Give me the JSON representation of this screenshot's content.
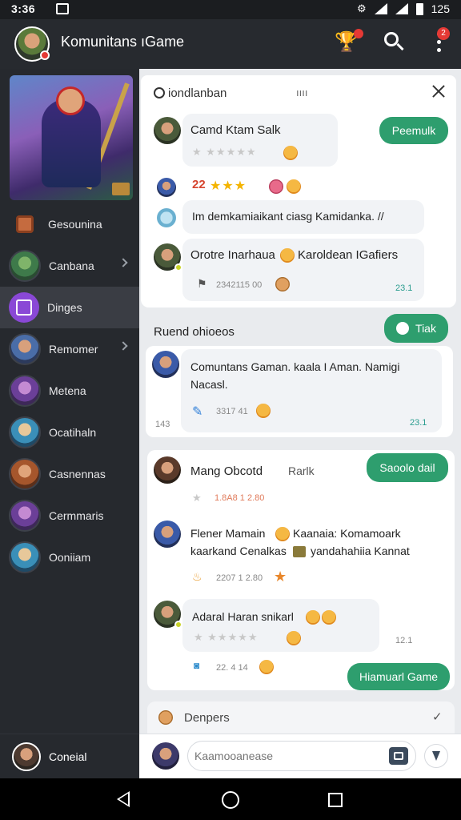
{
  "status_bar": {
    "time": "3:36",
    "battery": "125"
  },
  "app_bar": {
    "title": "Komunitans ıGame",
    "notification_count": "2"
  },
  "sidebar": {
    "items": [
      {
        "label": "Gesounina"
      },
      {
        "label": "Canbana"
      },
      {
        "label": "Dinges"
      },
      {
        "label": "Remomer"
      },
      {
        "label": "Metena"
      },
      {
        "label": "Ocatihaln"
      },
      {
        "label": "Casnennas"
      },
      {
        "label": "Cermmaris"
      },
      {
        "label": "Ooniiam"
      }
    ],
    "footer_label": "Coneial"
  },
  "main": {
    "topbar": {
      "title": "iondlanban",
      "mid": "ıııı"
    },
    "thread1": {
      "m1_title": "Camd Ktam Salk",
      "m1_button": "Peemulk",
      "m2_num": "22",
      "m3_text": "Im demkamiaikant ciasg Kamidanka. //",
      "m4_title": "Orotre Inarhaua",
      "m4_tail": "Karoldean IGafiers",
      "m4_meta": "2342115 00",
      "m4_side": "23.1"
    },
    "section2": {
      "title": "Ruend ohioeos",
      "button": "Tiak",
      "text_l1": "Comuntans Gaman. kaala I Aman. Namigi",
      "text_l2": "Nacasl.",
      "side_left": "143",
      "meta": "3317 41",
      "side_right": "23.1"
    },
    "thread3": {
      "m1_title": "Mang Obcotd",
      "m1_tail": "Rarlk",
      "m1_button": "Saoolo dail",
      "m1_meta": "1.8A8 1 2.80",
      "m2_l1": "Flener Mamain",
      "m2_l1b": "Kaanaia: Komamoark",
      "m2_l2": "kaarkand Cenalkas",
      "m2_l2b": "yandahahiia Kannat",
      "m2_meta": "2207 1 2.80",
      "m3_title": "Adaral Haran snikarl",
      "m3_side": "12.1",
      "m3_meta": "22. 4 14",
      "m3_button": "Hiamuarl Game"
    },
    "bottom_section": {
      "title": "Denpers"
    },
    "composer": {
      "placeholder": "Kaamooanease"
    }
  },
  "colors": {
    "accent_green": "#2e9e6e",
    "sidebar_bg": "#26292e",
    "active_purple": "#8a48d6",
    "badge_red": "#e53935"
  },
  "icons": [
    "bell-icon",
    "wifi-icon",
    "signal-icon",
    "battery-icon",
    "trophy-icon",
    "search-icon",
    "more-vert-icon",
    "close-icon",
    "clock-icon",
    "attach-icon",
    "mic-icon",
    "back-icon",
    "home-icon",
    "recents-icon"
  ]
}
